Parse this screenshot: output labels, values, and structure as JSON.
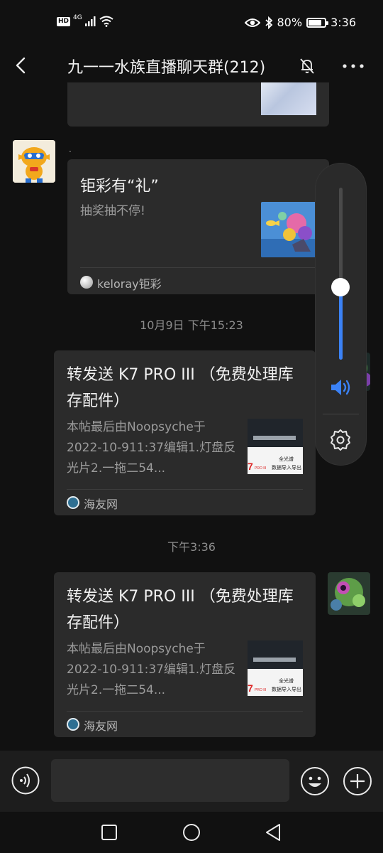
{
  "status_bar": {
    "hd": "HD",
    "network": "4G",
    "battery": "80%",
    "time": "3:36"
  },
  "header": {
    "title": "九一一水族直播聊天群(212)"
  },
  "messages": {
    "gift_card": {
      "sender": ".",
      "title": "钜彩有“礼”",
      "desc": "抽奖抽不停!",
      "source": "keloray钜彩"
    },
    "timestamp_1": "10月9日 下午15:23",
    "forward_1": {
      "title": "转发送 K7 PRO III （免费处理库存配件）",
      "desc": "本帖最后由Noopsyche于2022-10-911:37编辑1.灯盘反光片2.一拖二54...",
      "source": "海友网",
      "thumb_text_top": "全光谱",
      "thumb_text_bottom": "数据导入导出"
    },
    "timestamp_2": "下午3:36",
    "forward_2": {
      "title": "转发送 K7 PRO III （免费处理库存配件）",
      "desc": "本帖最后由Noopsyche于2022-10-911:37编辑1.灯盘反光片2.一拖二54...",
      "source": "海友网",
      "thumb_text_top": "全光谱",
      "thumb_text_bottom": "数据导入导出"
    }
  },
  "volume": {
    "level": 0.42,
    "icons": [
      "speaker-icon",
      "gear-icon"
    ]
  },
  "input": {
    "value": "",
    "placeholder": ""
  },
  "colors": {
    "background": "#111111",
    "card": "#2b2b2b",
    "accent": "#3b82f6"
  }
}
